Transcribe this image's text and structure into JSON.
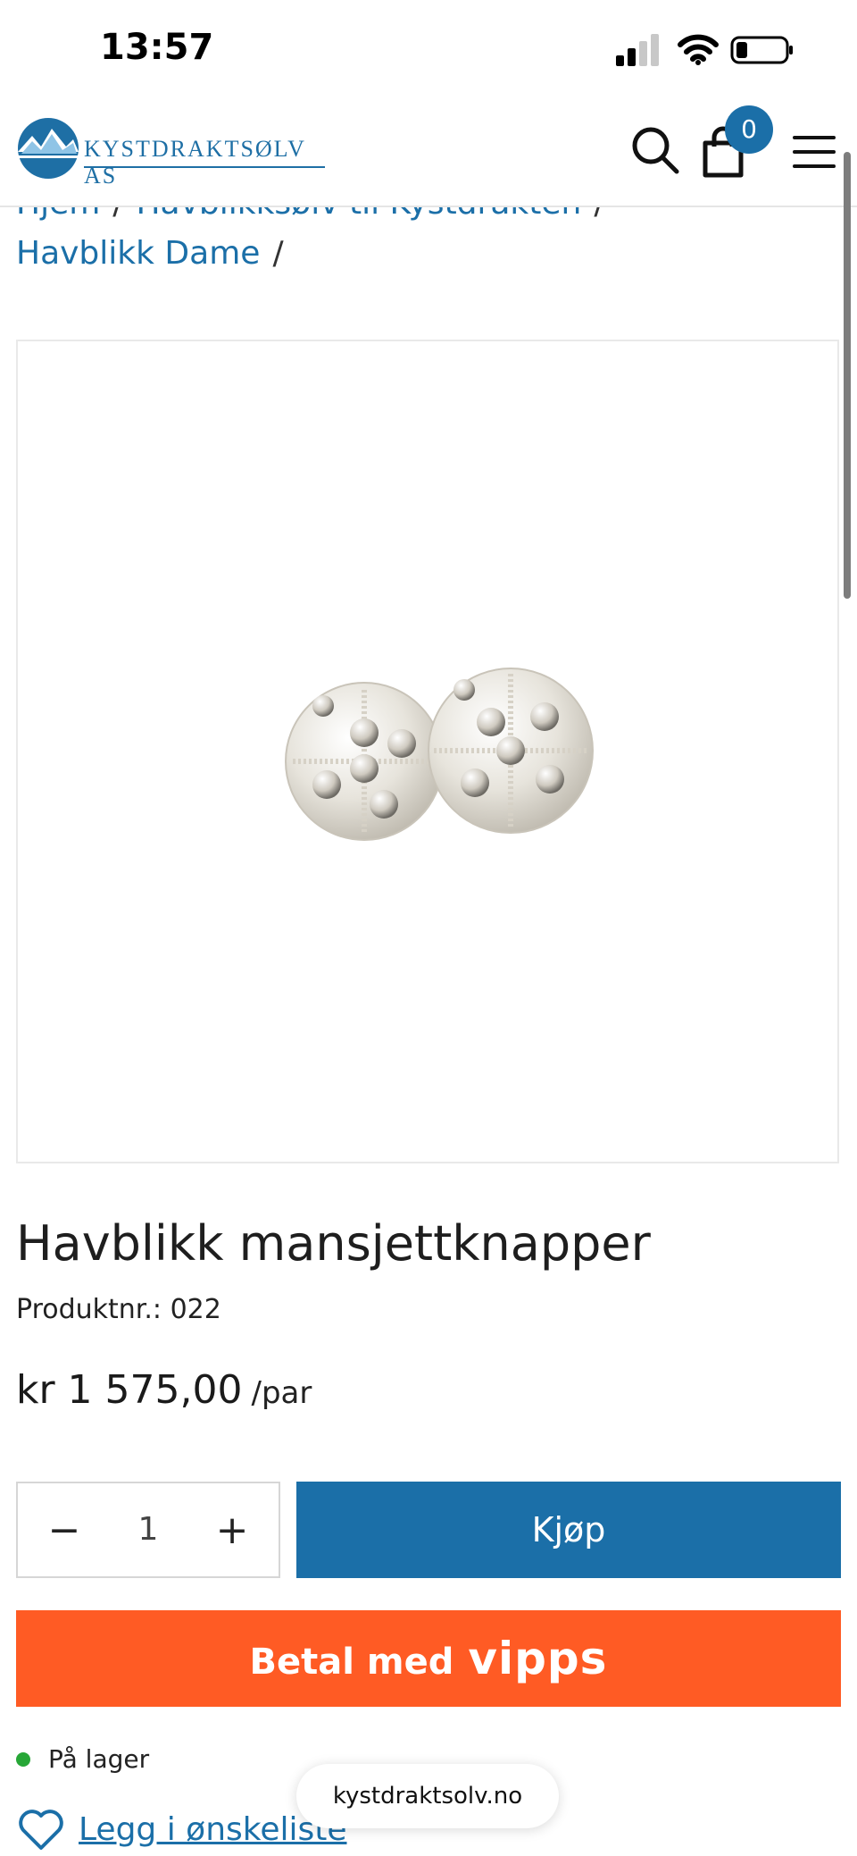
{
  "status_bar": {
    "time": "13:57",
    "icons": [
      "signal-icon",
      "wifi-icon",
      "battery-icon"
    ]
  },
  "header": {
    "logo_text": "KYSTDRAKTSØLV AS",
    "cart_count": "0",
    "icons": [
      "search-icon",
      "cart-icon",
      "menu-icon"
    ]
  },
  "breadcrumb": {
    "items": [
      {
        "label": "Hjem"
      },
      {
        "label": "Havblikksølv til Kystdrakten"
      },
      {
        "label": "Havblikk Dame"
      }
    ],
    "separator": "/"
  },
  "product": {
    "title": "Havblikk mansjettknapper",
    "number_label": "Produktnr.:",
    "number_value": "022",
    "price": "kr 1 575,00",
    "price_unit": "/par",
    "quantity": "1",
    "buy_label": "Kjøp",
    "vipps_label": "Betal med",
    "vipps_brand": "vipps",
    "stock_label": "På lager",
    "wishlist_label": "Legg i ønskeliste"
  },
  "browser": {
    "url": "kystdraktsolv.no"
  },
  "colors": {
    "brand_blue": "#1b6fa8",
    "vipps_orange": "#ff5b24",
    "stock_green": "#27a737"
  }
}
